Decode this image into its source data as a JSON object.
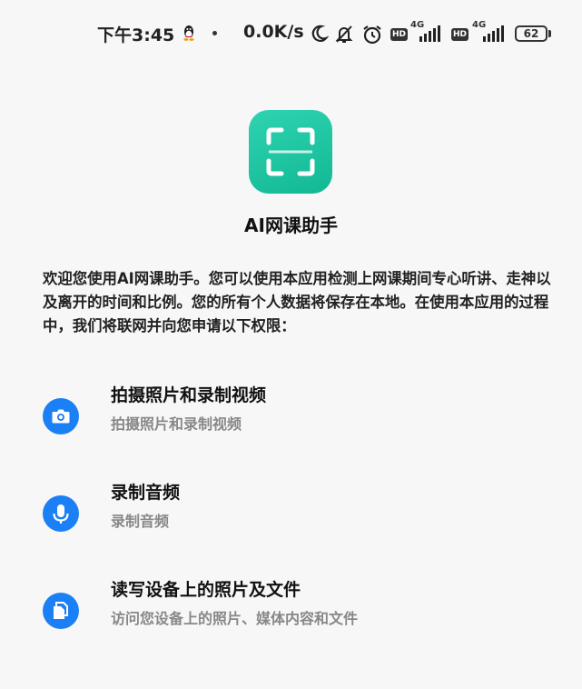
{
  "status_bar": {
    "time": "下午3:45",
    "net_speed": "0.0K/s",
    "hd_label": "HD",
    "network_type": "4G",
    "battery": "62",
    "icons": [
      "qq-icon",
      "moon-icon",
      "bell-off-icon",
      "alarm-icon",
      "signal-icon"
    ]
  },
  "app": {
    "icon": "scan-frame-icon",
    "name": "AI网课助手",
    "accent_color": "#1fc6a3"
  },
  "intro_text": "欢迎您使用AI网课助手。您可以使用本应用检测上网课期间专心听讲、走神以及离开的时间和比例。您的所有个人数据将保存在本地。在使用本应用的过程中，我们将联网并向您申请以下权限：",
  "permissions": [
    {
      "icon": "camera-icon",
      "title": "拍摄照片和录制视频",
      "description": "拍摄照片和录制视频"
    },
    {
      "icon": "microphone-icon",
      "title": "录制音频",
      "description": "录制音频"
    },
    {
      "icon": "files-icon",
      "title": "读写设备上的照片及文件",
      "description": "访问您设备上的照片、媒体内容和文件"
    }
  ],
  "colors": {
    "permission_icon_bg": "#1b7ff5",
    "background": "#f7f7f7"
  }
}
